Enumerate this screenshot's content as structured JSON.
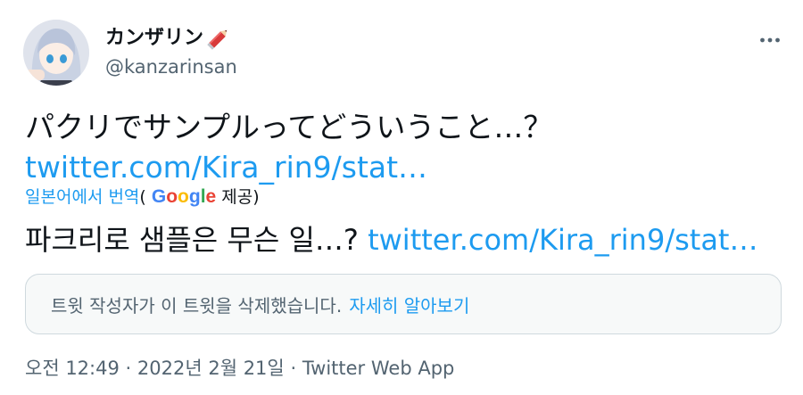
{
  "author": {
    "display_name": "カンザリン",
    "handle": "@kanzarinsan",
    "name_emoji_icon": "red-pencil-icon"
  },
  "tweet": {
    "text": "パクリでサンプルってどういうこと…？",
    "link": "twitter.com/Kira_rin9/stat…"
  },
  "translation": {
    "label": "일본어에서 번역",
    "paren_open": "(",
    "google_letters": [
      "G",
      "o",
      "o",
      "g",
      "l",
      "e"
    ],
    "provided": "제공)",
    "text": "파크리로 샘플은 무슨 일…?",
    "link": "twitter.com/Kira_rin9/stat…"
  },
  "deleted_notice": {
    "text": "트윗 작성자가 이 트윗을 삭제했습니다.",
    "learn_more": "자세히 알아보기"
  },
  "meta": {
    "time": "오전 12:49",
    "separator": "·",
    "date": "2022년 2월 21일",
    "source": "Twitter Web App"
  },
  "icons": {
    "more": "more-horizontal-icon"
  },
  "colors": {
    "link": "#1d9bf0",
    "secondary_text": "#536471",
    "primary_text": "#0f1419",
    "notice_bg": "#f7f9f9",
    "border": "#cfd9de"
  }
}
